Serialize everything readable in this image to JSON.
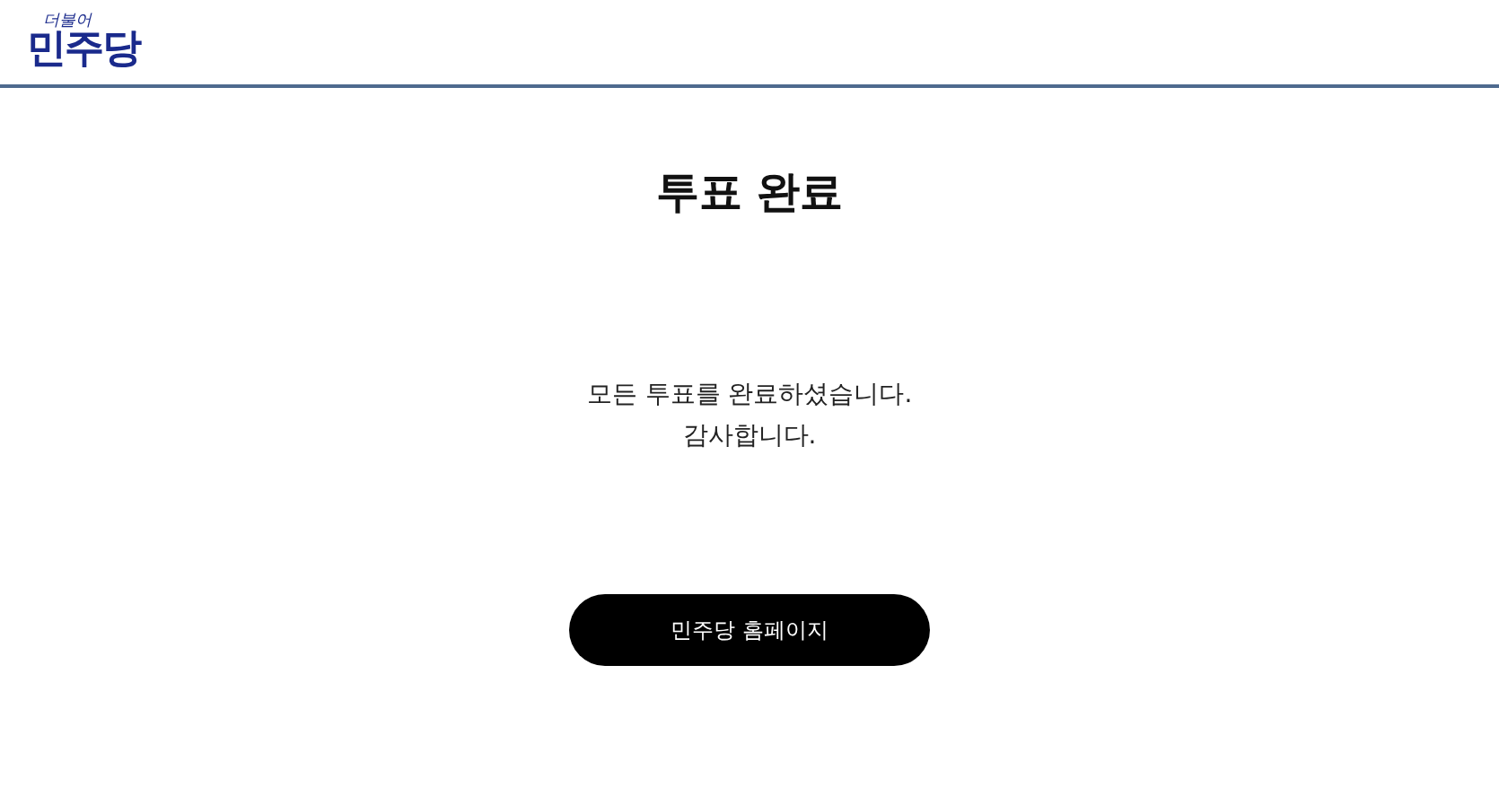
{
  "header": {
    "logo": {
      "tagline": "더불어",
      "name": "민주당"
    }
  },
  "title": "투표 완료",
  "message": [
    "모든 투표를 완료하셨습니다.",
    "감사합니다."
  ],
  "button": "민주당 홈페이지"
}
